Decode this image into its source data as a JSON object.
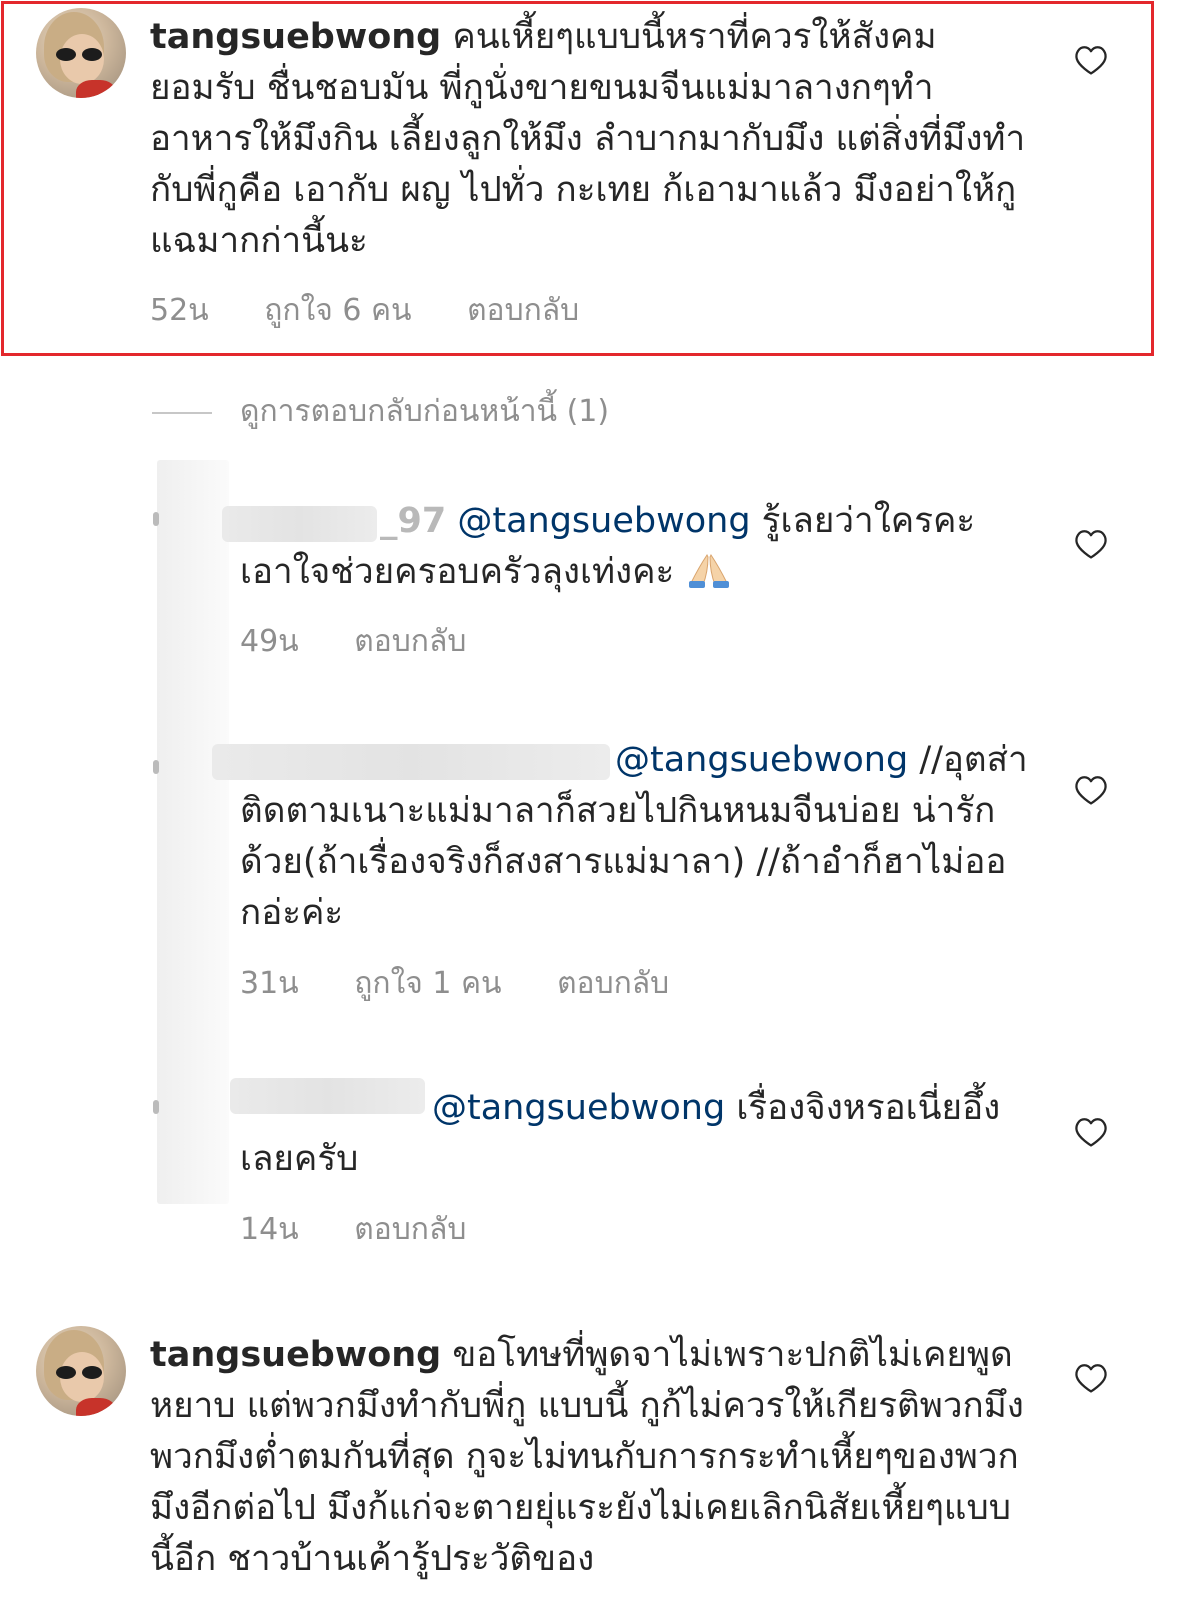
{
  "colors": {
    "highlight_border": "#e3272c",
    "mention_blue": "#003569",
    "meta_gray": "#8e8e8e",
    "text_dark": "#262626"
  },
  "comments": [
    {
      "username": "tangsuebwong",
      "text": "คนเหี้ยๆแบบนี้หราที่ควรให้สังคมยอมรับ  ชื่นชอบมัน พี่กูนั่งขายขนมจีนแม่มาลางกๆทำอาหารให้มึงกิน  เลี้ยงลูกให้มึง ลำบากมากับมึง แต่สิ่งที่มึงทำกับพี่กูคือ เอากับ ผญ ไปทั่ว กะเทย ก้เอามาแล้ว มึงอย่าให้กูแฉมากก่านี้นะ",
      "time": "52น",
      "likes": "ถูกใจ 6 คน",
      "reply_label": "ตอบกลับ",
      "highlighted": true
    }
  ],
  "view_replies_label": "ดูการตอบกลับก่อนหน้านี้ (1)",
  "replies": [
    {
      "username_partial": "_97",
      "mention": "@tangsuebwong",
      "text": " รู้เลยว่าใครคะเอาใจช่วยครอบครัวลุงเท่งคะ",
      "emoji": "folded-hands",
      "time": "49น",
      "reply_label": "ตอบกลับ"
    },
    {
      "mention": "@tangsuebwong",
      "text": " //อุตส่าติดตามเนาะแม่มาลาก็สวยไปกินหนมจีนบ่อย น่ารักด้วย(ถ้าเรื่องจริงก็สงสารแม่มาลา) //ถ้าอำก็ฮาไม่ออกอ่ะค่ะ",
      "time": "31น",
      "likes": "ถูกใจ 1 คน",
      "reply_label": "ตอบกลับ"
    },
    {
      "mention": "@tangsuebwong",
      "text": " เรื่องจิงหรอเนี่ยอึ้งเลยครับ",
      "time": "14น",
      "reply_label": "ตอบกลับ"
    }
  ],
  "comment2": {
    "username": "tangsuebwong",
    "text": "ขอโทษที่พูดจาไม่เพราะปกติไม่เคยพูดหยาบ แต่พวกมึงทำกับพี่กู แบบนี้ กูก้ไม่ควรให้เกียรติพวกมึง พวกมึงต่ำตมกันที่สุด กูจะไม่ทนกับการกระทำเหี้ยๆของพวกมึงอีกต่อไป มึงก้แก่จะตายยุ่แระยังไม่เคยเลิกนิสัยเหี้ยๆแบบนี้อีก ชาวบ้านเค้ารู้ประวัติของ"
  }
}
